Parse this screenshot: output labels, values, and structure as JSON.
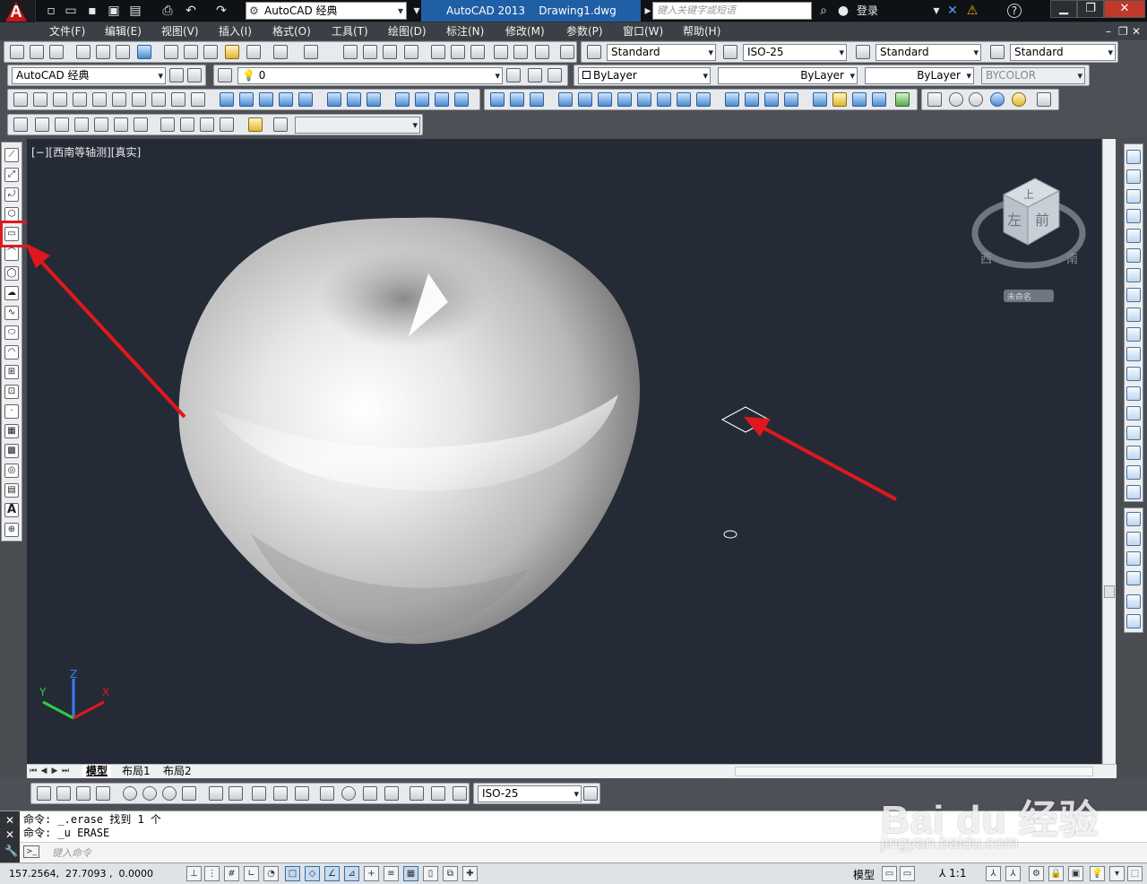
{
  "titlebar": {
    "app_name": "AutoCAD 2013",
    "file_name": "Drawing1.dwg",
    "title_full": "AutoCAD 2013    Drawing1.dwg",
    "workspace": "AutoCAD 经典",
    "search_placeholder": "键入关键字或短语",
    "login_label": "登录",
    "help_label": "?"
  },
  "menus": [
    "文件(F)",
    "编辑(E)",
    "视图(V)",
    "插入(I)",
    "格式(O)",
    "工具(T)",
    "绘图(D)",
    "标注(N)",
    "修改(M)",
    "参数(P)",
    "窗口(W)",
    "帮助(H)"
  ],
  "styles_toolbar": {
    "text_style": "Standard",
    "dim_style": "ISO-25",
    "table_style": "Standard",
    "mleader_style": "Standard"
  },
  "layers_toolbar": {
    "workspace": "AutoCAD 经典",
    "current_layer": "0",
    "color": "ByLayer",
    "linetype": "ByLayer",
    "lineweight": "ByLayer",
    "plot_style": "BYCOLOR"
  },
  "viewport": {
    "label": "[−][西南等轴测][真实]",
    "viewcube": {
      "top": "上",
      "left": "左",
      "front": "前",
      "compass_west": "西",
      "compass_south": "南",
      "ucs_name": "未命名"
    },
    "ucs_icon": {
      "z": "Z",
      "y": "Y",
      "x": "X"
    }
  },
  "layout_tabs": [
    "模型",
    "布局1",
    "布局2"
  ],
  "dim_toolbar": {
    "dim_style": "ISO-25"
  },
  "command": {
    "history": [
      "命令: _.erase 找到 1 个",
      "命令: _u ERASE"
    ],
    "input_placeholder": "键入命令"
  },
  "statusbar": {
    "coords": "157.2564,  27.7093 ,  0.0000",
    "model_label": "模型",
    "annotation_scale": "1:1"
  },
  "watermark": {
    "text": "Bai du 经验",
    "sub": "jingyan.baidu.com"
  },
  "colors": {
    "viewport_bg": "#252b36",
    "annotation_red": "#e0181c",
    "title_blue": "#1f5fa6"
  }
}
